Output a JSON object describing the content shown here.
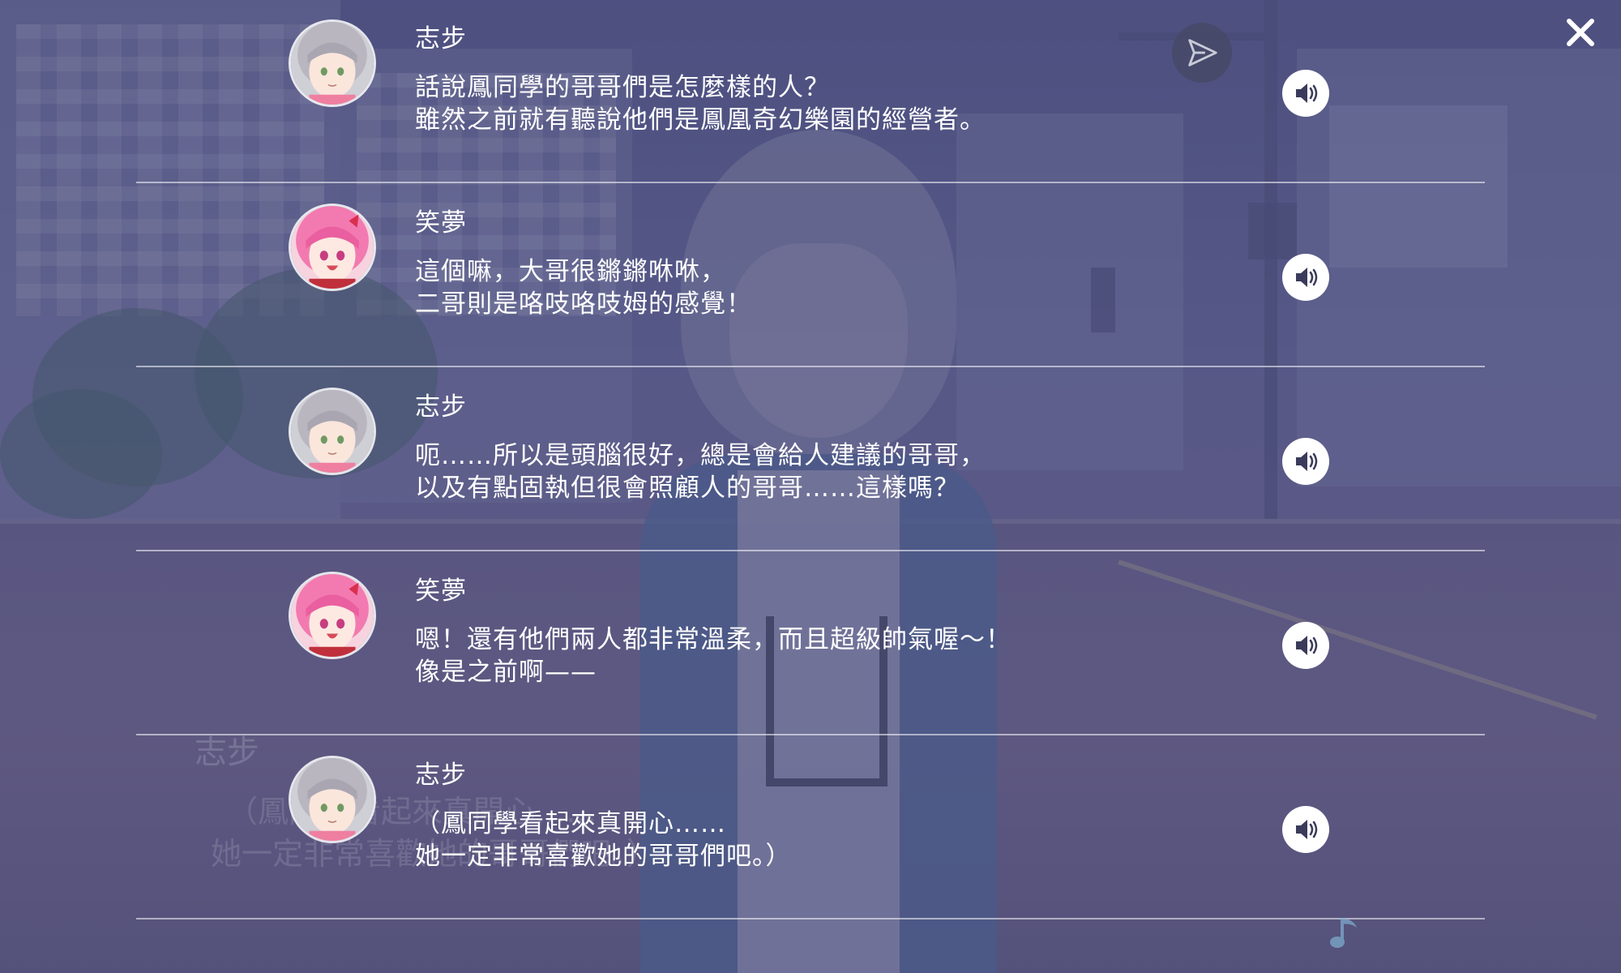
{
  "colors": {
    "overlay": "#3c3e6e",
    "text": "#ffffff",
    "voice_button_bg": "#ffffff",
    "voice_icon": "#3a3b5c",
    "shiho_hair": "#b9b6bf",
    "emu_hair": "#f27ab0"
  },
  "icons": {
    "close": "close-icon",
    "send": "send-icon",
    "voice": "speaker-icon",
    "music": "music-note-icon"
  },
  "background_dialogue": {
    "speaker": "志步",
    "line1": "（鳳同學看起來真開心……",
    "line2": "她一定非常喜歡她的哥哥們吧。）"
  },
  "backlog": [
    {
      "speaker": "志步",
      "avatar": "shiho",
      "line1": "話說鳳同學的哥哥們是怎麼樣的人？",
      "line2": "雖然之前就有聽說他們是鳳凰奇幻樂園的經營者。"
    },
    {
      "speaker": "笑夢",
      "avatar": "emu",
      "line1": "這個嘛，大哥很鏘鏘咻咻，",
      "line2": "二哥則是咯吱咯吱姆的感覺！"
    },
    {
      "speaker": "志步",
      "avatar": "shiho",
      "line1": "呃……所以是頭腦很好，總是會給人建議的哥哥，",
      "line2": "以及有點固執但很會照顧人的哥哥……這樣嗎？"
    },
    {
      "speaker": "笑夢",
      "avatar": "emu",
      "line1": "嗯！還有他們兩人都非常溫柔，而且超級帥氣喔～！",
      "line2": "像是之前啊——"
    },
    {
      "speaker": "志步",
      "avatar": "shiho",
      "line1": "（鳳同學看起來真開心……",
      "line2": "她一定非常喜歡她的哥哥們吧。）"
    }
  ]
}
